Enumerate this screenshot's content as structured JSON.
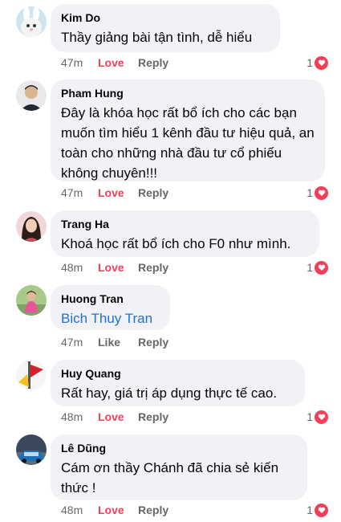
{
  "comments": [
    {
      "author": "Kim Do",
      "text": "Thầy giảng bài tận tình, dễ hiểu",
      "time": "47m",
      "reaction_label": "Love",
      "reply_label": "Reply",
      "reaction_count": "1",
      "avatar": "bunny-avatar"
    },
    {
      "author": "Pham Hung",
      "text": "Đây là khóa học rất bổ ích cho các bạn muốn tìm hiểu 1 kênh đầu tư hiệu quả, an toàn cho những nhà đầu tư cổ phiếu không chuyên!!!",
      "time": "47m",
      "reaction_label": "Love",
      "reply_label": "Reply",
      "reaction_count": "1",
      "avatar": "man-avatar"
    },
    {
      "author": "Trang Ha",
      "text": "Khoá học rất bổ ích cho F0 như mình.",
      "time": "48m",
      "reaction_label": "Love",
      "reply_label": "Reply",
      "reaction_count": "1",
      "avatar": "woman-avatar"
    },
    {
      "author": "Huong Tran",
      "text": "Bich Thuy Tran",
      "time": "47m",
      "reaction_label": "Like",
      "reply_label": "Reply",
      "reaction_count": "",
      "avatar": "woman-outdoor-avatar"
    },
    {
      "author": "Huy Quang",
      "text": "Rất hay, giá trị áp dụng thực tế cao.",
      "time": "48m",
      "reaction_label": "Love",
      "reply_label": "Reply",
      "reaction_count": "1",
      "avatar": "flag-avatar"
    },
    {
      "author": "Lê Dũng",
      "text": "Cám ơn thầy Chánh đã chia sẻ kiến thức !",
      "time": "48m",
      "reaction_label": "Love",
      "reply_label": "Reply",
      "reaction_count": "1",
      "avatar": "car-avatar"
    }
  ],
  "colors": {
    "love": "#f33e58",
    "link": "#216fdb",
    "bubble": "#f0f2f5",
    "muted": "#65676b"
  }
}
